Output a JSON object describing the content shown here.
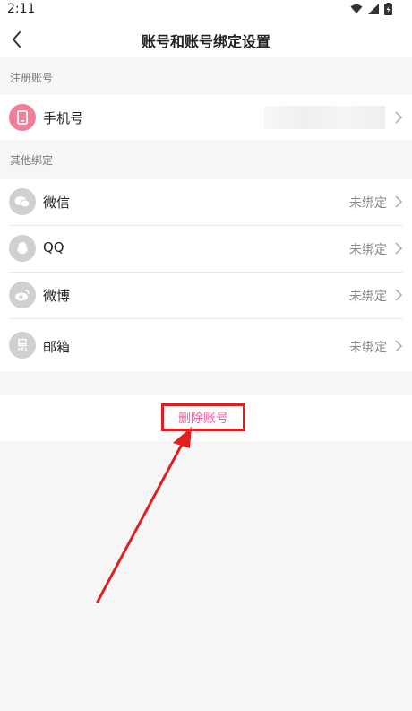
{
  "status": {
    "time": "2:11"
  },
  "header": {
    "title": "账号和账号绑定设置"
  },
  "sections": {
    "registered": "注册账号",
    "others": "其他绑定"
  },
  "registered": {
    "label": "手机号"
  },
  "bindings": [
    {
      "label": "微信",
      "status": "未绑定",
      "icon": "wechat-icon"
    },
    {
      "label": "QQ",
      "status": "未绑定",
      "icon": "qq-icon"
    },
    {
      "label": "微博",
      "status": "未绑定",
      "icon": "weibo-icon"
    },
    {
      "label": "邮箱",
      "status": "未绑定",
      "icon": "email-icon"
    }
  ],
  "delete": {
    "label": "删除账号"
  },
  "colors": {
    "accent": "#ec5a9f",
    "highlight": "#e02020",
    "phone_icon": "#f27f99"
  }
}
